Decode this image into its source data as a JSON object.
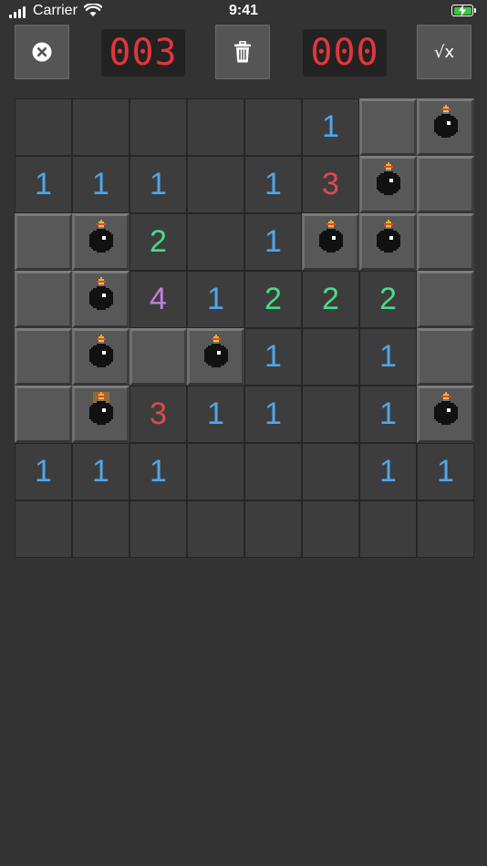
{
  "status_bar": {
    "carrier": "Carrier",
    "time": "9:41"
  },
  "toolbar": {
    "mine_counter": "003",
    "timer": "000",
    "close_icon": "close-icon",
    "trash_icon": "trash-icon",
    "hint_label": "√x"
  },
  "colors": {
    "1": "#4fa6ea",
    "2": "#4bdb8a",
    "3": "#e0484f",
    "4": "#c77de0"
  },
  "board": {
    "rows": 8,
    "cols": 8,
    "cells": [
      [
        "o",
        "o",
        "o",
        "o",
        "o",
        "1",
        "c",
        "b"
      ],
      [
        "1",
        "1",
        "1",
        "o",
        "1",
        "3",
        "b",
        "c"
      ],
      [
        "c",
        "b",
        "2",
        "o",
        "1",
        "b",
        "b",
        "c"
      ],
      [
        "c",
        "b",
        "4",
        "1",
        "2",
        "2",
        "2",
        "c"
      ],
      [
        "c",
        "b",
        "c",
        "b",
        "1",
        "o",
        "1",
        "c"
      ],
      [
        "c",
        "bx",
        "3",
        "1",
        "1",
        "o",
        "1",
        "b"
      ],
      [
        "1",
        "1",
        "1",
        "o",
        "o",
        "o",
        "1",
        "1"
      ],
      [
        "o",
        "o",
        "o",
        "o",
        "o",
        "o",
        "o",
        "o"
      ]
    ]
  }
}
